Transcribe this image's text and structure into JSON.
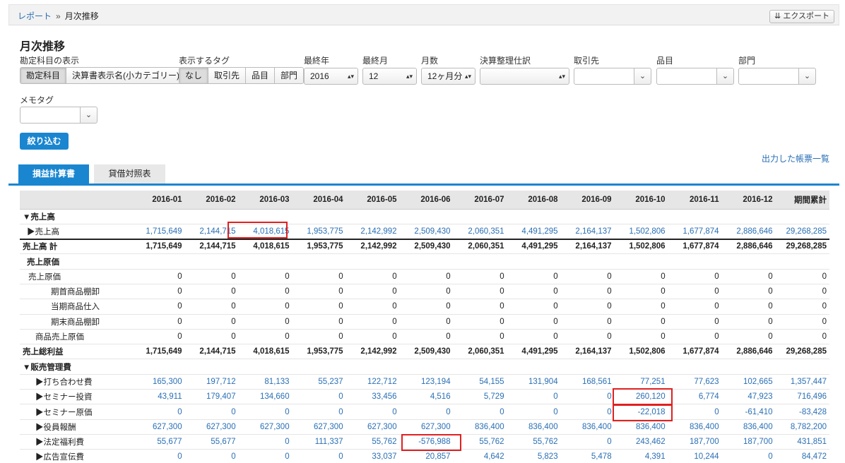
{
  "breadcrumb": {
    "root": "レポート",
    "separator": "»",
    "current": "月次推移"
  },
  "export_label": "エクスポート",
  "page_title": "月次推移",
  "filters": {
    "account_display": {
      "label": "勘定科目の表示",
      "options": [
        "勘定科目",
        "決算書表示名(小カテゴリー)"
      ],
      "selected": "勘定科目"
    },
    "tags": {
      "label": "表示するタグ",
      "options": [
        "なし",
        "取引先",
        "品目",
        "部門"
      ],
      "selected": "なし"
    },
    "last_year": {
      "label": "最終年",
      "value": "2016"
    },
    "last_month": {
      "label": "最終月",
      "value": "12"
    },
    "months": {
      "label": "月数",
      "value": "12ヶ月分"
    },
    "closing": {
      "label": "決算整理仕訳",
      "value": ""
    },
    "partner": {
      "label": "取引先",
      "value": ""
    },
    "item": {
      "label": "品目",
      "value": ""
    },
    "department": {
      "label": "部門",
      "value": ""
    },
    "memo_tag": {
      "label": "メモタグ",
      "value": ""
    },
    "submit_label": "絞り込む"
  },
  "output_link": "出力した帳票一覧",
  "tabs": [
    {
      "label": "損益計算書",
      "active": true
    },
    {
      "label": "貸借対照表",
      "active": false
    }
  ],
  "table": {
    "columns": [
      "",
      "2016-01",
      "2016-02",
      "2016-03",
      "2016-04",
      "2016-05",
      "2016-06",
      "2016-07",
      "2016-08",
      "2016-09",
      "2016-10",
      "2016-11",
      "2016-12",
      "期間累計"
    ],
    "rows": [
      {
        "label": "▼売上高",
        "kind": "group",
        "indent": 0,
        "values": []
      },
      {
        "label": "▶売上高",
        "kind": "link",
        "indent": 1,
        "values": [
          "1,715,649",
          "2,144,715",
          "4,018,615",
          "1,953,775",
          "2,142,992",
          "2,509,430",
          "2,060,351",
          "4,491,295",
          "2,164,137",
          "1,502,806",
          "1,677,874",
          "2,886,646",
          "29,268,285"
        ]
      },
      {
        "label": "売上高 計",
        "kind": "total",
        "indent": 0,
        "values": [
          "1,715,649",
          "2,144,715",
          "4,018,615",
          "1,953,775",
          "2,142,992",
          "2,509,430",
          "2,060,351",
          "4,491,295",
          "2,164,137",
          "1,502,806",
          "1,677,874",
          "2,886,646",
          "29,268,285"
        ]
      },
      {
        "label": "売上原価",
        "kind": "group",
        "indent": 1,
        "values": []
      },
      {
        "label": "売上原価",
        "kind": "plain",
        "indent": 2,
        "values": [
          "0",
          "0",
          "0",
          "0",
          "0",
          "0",
          "0",
          "0",
          "0",
          "0",
          "0",
          "0",
          "0"
        ]
      },
      {
        "label": "期首商品棚卸",
        "kind": "plain",
        "indent": 3,
        "values": [
          "0",
          "0",
          "0",
          "0",
          "0",
          "0",
          "0",
          "0",
          "0",
          "0",
          "0",
          "0",
          "0"
        ]
      },
      {
        "label": "当期商品仕入",
        "kind": "plain",
        "indent": 3,
        "values": [
          "0",
          "0",
          "0",
          "0",
          "0",
          "0",
          "0",
          "0",
          "0",
          "0",
          "0",
          "0",
          "0"
        ]
      },
      {
        "label": "期末商品棚卸",
        "kind": "plain",
        "indent": 3,
        "values": [
          "0",
          "0",
          "0",
          "0",
          "0",
          "0",
          "0",
          "0",
          "0",
          "0",
          "0",
          "0",
          "0"
        ]
      },
      {
        "label": "商品売上原価",
        "kind": "plain",
        "indent": 4,
        "values": [
          "0",
          "0",
          "0",
          "0",
          "0",
          "0",
          "0",
          "0",
          "0",
          "0",
          "0",
          "0",
          "0"
        ]
      },
      {
        "label": "売上総利益",
        "kind": "total",
        "indent": 0,
        "values": [
          "1,715,649",
          "2,144,715",
          "4,018,615",
          "1,953,775",
          "2,142,992",
          "2,509,430",
          "2,060,351",
          "4,491,295",
          "2,164,137",
          "1,502,806",
          "1,677,874",
          "2,886,646",
          "29,268,285"
        ]
      },
      {
        "label": "▼販売管理費",
        "kind": "group",
        "indent": 0,
        "values": []
      },
      {
        "label": "▶打ち合わせ費",
        "kind": "link",
        "indent": 5,
        "values": [
          "165,300",
          "197,712",
          "81,133",
          "55,237",
          "122,712",
          "123,194",
          "54,155",
          "131,904",
          "168,561",
          "77,251",
          "77,623",
          "102,665",
          "1,357,447"
        ]
      },
      {
        "label": "▶セミナー投資",
        "kind": "link",
        "indent": 5,
        "values": [
          "43,911",
          "179,407",
          "134,660",
          "0",
          "33,456",
          "4,516",
          "5,729",
          "0",
          "0",
          "260,120",
          "6,774",
          "47,923",
          "716,496"
        ]
      },
      {
        "label": "▶セミナー原価",
        "kind": "link",
        "indent": 5,
        "values": [
          "0",
          "0",
          "0",
          "0",
          "0",
          "0",
          "0",
          "0",
          "0",
          "-22,018",
          "0",
          "-61,410",
          "-83,428"
        ]
      },
      {
        "label": "▶役員報酬",
        "kind": "link",
        "indent": 5,
        "values": [
          "627,300",
          "627,300",
          "627,300",
          "627,300",
          "627,300",
          "627,300",
          "836,400",
          "836,400",
          "836,400",
          "836,400",
          "836,400",
          "836,400",
          "8,782,200"
        ]
      },
      {
        "label": "▶法定福利費",
        "kind": "link",
        "indent": 5,
        "values": [
          "55,677",
          "55,677",
          "0",
          "111,337",
          "55,762",
          "-576,988",
          "55,762",
          "55,762",
          "0",
          "243,462",
          "187,700",
          "187,700",
          "431,851"
        ]
      },
      {
        "label": "▶広告宣伝費",
        "kind": "link",
        "indent": 5,
        "values": [
          "0",
          "0",
          "0",
          "0",
          "33,037",
          "20,857",
          "4,642",
          "5,823",
          "5,478",
          "4,391",
          "10,244",
          "0",
          "84,472"
        ]
      }
    ]
  },
  "highlight_color": "#e02020"
}
